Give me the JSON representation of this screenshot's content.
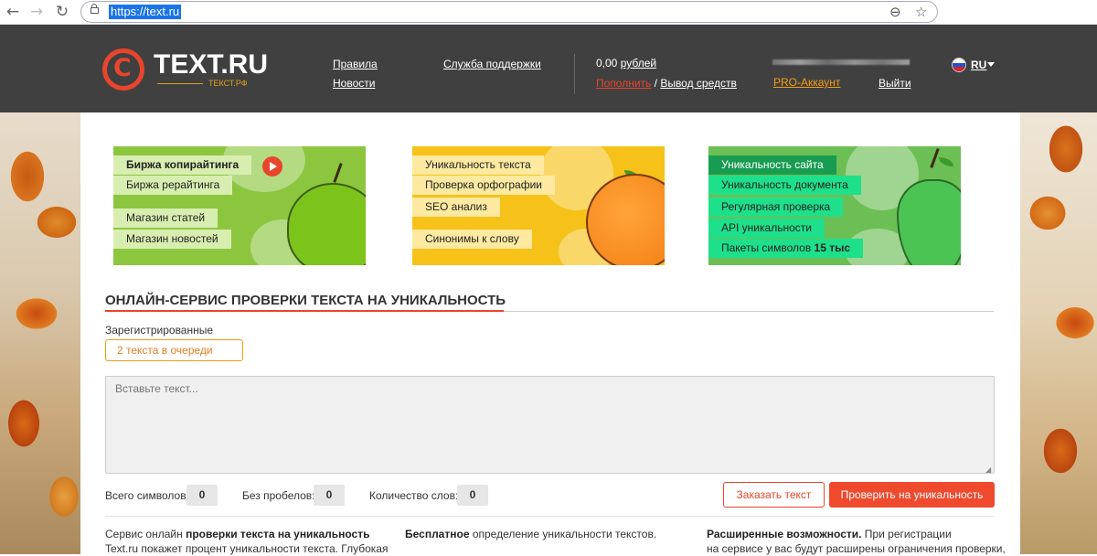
{
  "browser": {
    "url": "https://text.ru",
    "back_icon": "←",
    "forward_icon": "→",
    "reload_icon": "↻",
    "zoom_icon": "⊖",
    "star_icon": "☆"
  },
  "header": {
    "logo_text": "TEXT.RU",
    "logo_sub": "ТЕКСТ.РФ",
    "nav": {
      "rules": "Правила",
      "news": "Новости",
      "support": "Служба поддержки"
    },
    "balance_amount": "0,00",
    "balance_currency": "рублей",
    "topup": "Пополнить",
    "topup_sep": " / ",
    "withdraw": "Вывод средств",
    "pro": "PRO-Аккаунт",
    "logout": "Выйти",
    "lang": "RU"
  },
  "banners": {
    "copywriting": {
      "items": [
        "Биржа копирайтинга",
        "Биржа рерайтинга",
        "Магазин статей",
        "Магазин новостей"
      ]
    },
    "uniqueness": {
      "items": [
        "Уникальность текста",
        "Проверка орфографии",
        "SEO анализ",
        "Синонимы к слову"
      ]
    },
    "site": {
      "items": [
        "Уникальность сайта",
        "Уникальность документа",
        "Регулярная проверка",
        "API уникальности"
      ],
      "packets_label": "Пакеты символов",
      "packets_value": "15 тыс"
    }
  },
  "main": {
    "title": "ОНЛАЙН-СЕРВИС ПРОВЕРКИ ТЕКСТА НА УНИКАЛЬНОСТЬ",
    "registered_label": "Зарегистрированные",
    "queue_button": "2 текста в очереди",
    "textarea_placeholder": "Вставьте текст...",
    "stats": {
      "total_label": "Всего символов:",
      "total_value": "0",
      "nospace_label": "Без пробелов:",
      "nospace_value": "0",
      "words_label": "Количество слов:",
      "words_value": "0"
    },
    "order_button": "Заказать текст",
    "check_button": "Проверить на уникальность"
  },
  "description": {
    "col1_prefix": "Сервис онлайн ",
    "col1_bold": "проверки текста на уникальность",
    "col1_line2": "Text.ru покажет процент уникальности текста. Глубокая",
    "col2_bold": "Бесплатное",
    "col2_rest": " определение уникальности текстов.",
    "col3_bold": "Расширенные возможности.",
    "col3_rest": " При регистрации",
    "col3_line2": "на сервисе у вас будут расширены ограничения проверки,"
  },
  "colors": {
    "header_bg": "#404040",
    "accent_red": "#e8452c",
    "accent_orange": "#f39c12"
  }
}
